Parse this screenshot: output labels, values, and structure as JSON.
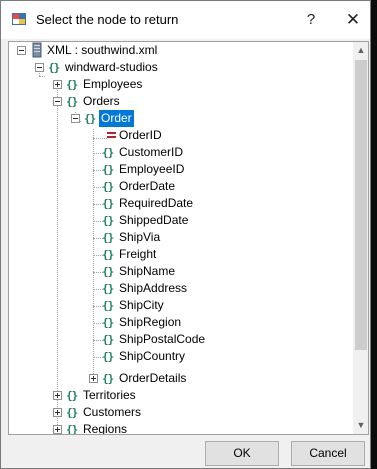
{
  "window": {
    "title": "Select the node to return",
    "help_label": "?",
    "close_label": "✕"
  },
  "tree": {
    "root": "XML : southwind.xml",
    "level1": "windward-studios",
    "employees": "Employees",
    "orders": "Orders",
    "order": "Order",
    "order_attr": "OrderID",
    "order_children": [
      "CustomerID",
      "EmployeeID",
      "OrderDate",
      "RequiredDate",
      "ShippedDate",
      "ShipVia",
      "Freight",
      "ShipName",
      "ShipAddress",
      "ShipCity",
      "ShipRegion",
      "ShipPostalCode",
      "ShipCountry"
    ],
    "order_details": "OrderDetails",
    "territories": "Territories",
    "customers": "Customers",
    "regions": "Regions",
    "selected": "Order"
  },
  "buttons": {
    "ok": "OK",
    "cancel": "Cancel"
  },
  "icons": {
    "element": "braces-icon",
    "attribute": "attribute-icon",
    "database": "database-icon",
    "app": "dialog-app-icon"
  },
  "colors": {
    "selection": "#0078d7",
    "element_icon": "#1e7f5c",
    "attribute_icon": "#b1262a"
  }
}
